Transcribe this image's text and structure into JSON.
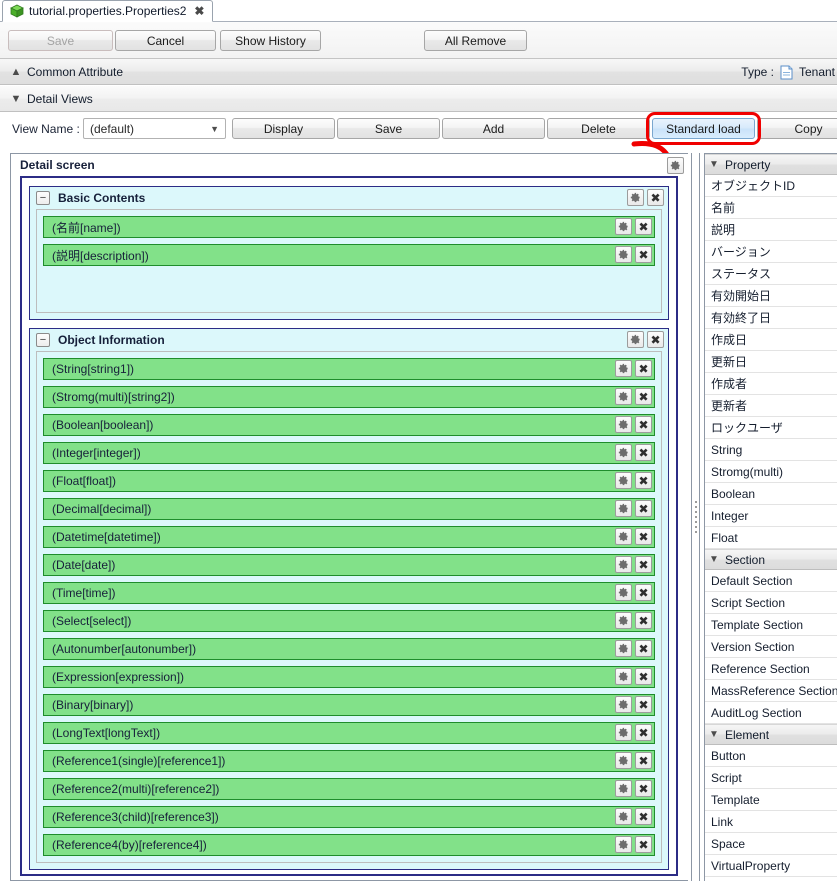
{
  "tab": {
    "label": "tutorial.properties.Properties2",
    "icon": "cube-icon",
    "close": "✖"
  },
  "toolbar": {
    "save": "Save",
    "cancel": "Cancel",
    "show_history": "Show History",
    "all_remove": "All Remove"
  },
  "sections": {
    "common_attribute": "Common Attribute",
    "detail_views": "Detail Views",
    "type_label": "Type :",
    "type_value": "Tenant"
  },
  "view": {
    "name_label": "View Name :",
    "selected": "(default)",
    "chevron": "∨",
    "buttons": {
      "display": "Display",
      "save": "Save",
      "add": "Add",
      "delete": "Delete",
      "standard_load": "Standard load",
      "copy": "Copy"
    }
  },
  "detail_screen": {
    "title": "Detail screen",
    "blocks": [
      {
        "title": "Basic Contents",
        "collapse": "−",
        "rows": [
          {
            "label": "(名前[name])"
          },
          {
            "label": "(説明[description])"
          }
        ]
      },
      {
        "title": "Object Information",
        "collapse": "−",
        "rows": [
          {
            "label": "(String[string1])"
          },
          {
            "label": "(Stromg(multi)[string2])"
          },
          {
            "label": "(Boolean[boolean])"
          },
          {
            "label": "(Integer[integer])"
          },
          {
            "label": "(Float[float])"
          },
          {
            "label": "(Decimal[decimal])"
          },
          {
            "label": "(Datetime[datetime])"
          },
          {
            "label": "(Date[date])"
          },
          {
            "label": "(Time[time])"
          },
          {
            "label": "(Select[select])"
          },
          {
            "label": "(Autonumber[autonumber])"
          },
          {
            "label": "(Expression[expression])"
          },
          {
            "label": "(Binary[binary])"
          },
          {
            "label": "(LongText[longText])"
          },
          {
            "label": "(Reference1(single)[reference1])"
          },
          {
            "label": "(Reference2(multi)[reference2])"
          },
          {
            "label": "(Reference3(child)[reference3])"
          },
          {
            "label": "(Reference4(by)[reference4])"
          }
        ]
      }
    ]
  },
  "palette": [
    {
      "group": "Property",
      "caret": "∨",
      "items": [
        "オブジェクトID",
        "名前",
        "説明",
        "バージョン",
        "ステータス",
        "有効開始日",
        "有効終了日",
        "作成日",
        "更新日",
        "作成者",
        "更新者",
        "ロックユーザ",
        "String",
        "Stromg(multi)",
        "Boolean",
        "Integer",
        "Float"
      ]
    },
    {
      "group": "Section",
      "caret": "∨",
      "items": [
        "Default Section",
        "Script Section",
        "Template Section",
        "Version Section",
        "Reference Section",
        "MassReference Section",
        "AuditLog Section"
      ]
    },
    {
      "group": "Element",
      "caret": "∨",
      "items": [
        "Button",
        "Script",
        "Template",
        "Link",
        "Space",
        "VirtualProperty"
      ]
    }
  ],
  "annotation": {
    "highlight_target": "Standard load",
    "color": "#f00000"
  },
  "colors": {
    "row_green": "#82e189",
    "row_green_border": "#1f8d2c",
    "block_cyan": "#dcf8fb",
    "canvas_border": "#2c2c86",
    "highlight_blue": "#d7eafb"
  }
}
